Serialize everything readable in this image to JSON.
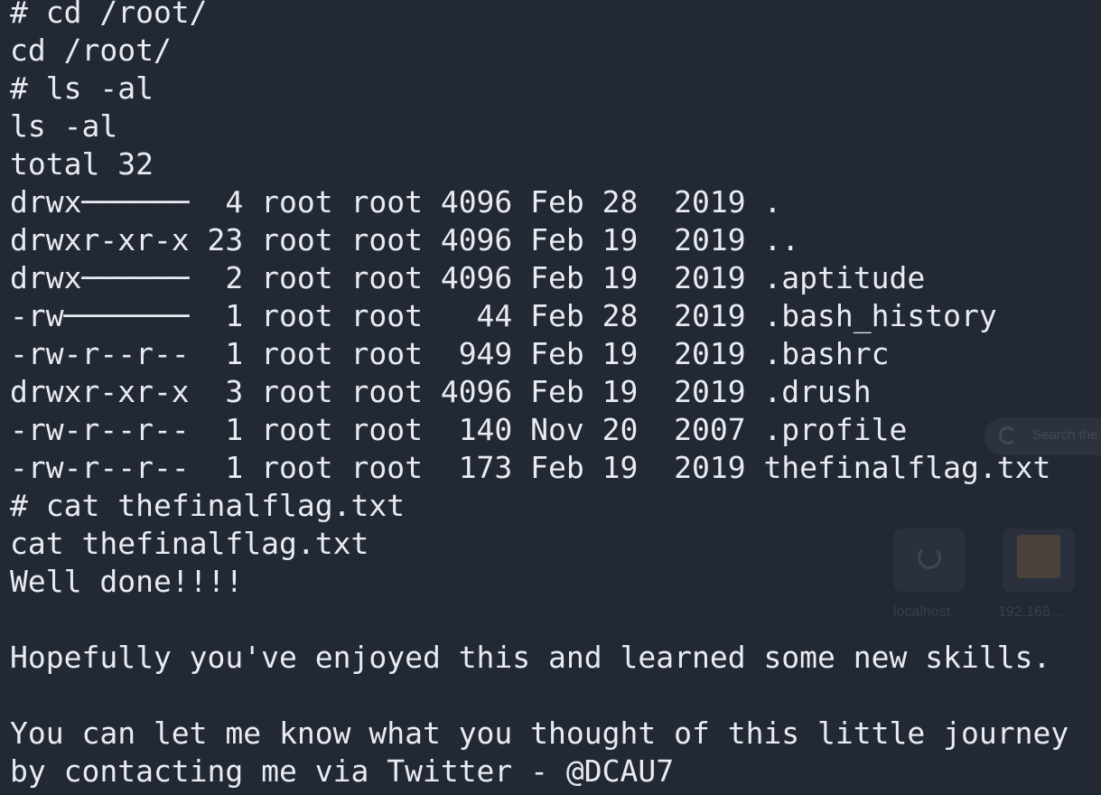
{
  "terminal": {
    "lines": [
      "# cd /root/",
      "cd /root/",
      "# ls -al",
      "ls -al",
      "total 32",
      "drwx──────  4 root root 4096 Feb 28  2019 .",
      "drwxr-xr-x 23 root root 4096 Feb 19  2019 ..",
      "drwx──────  2 root root 4096 Feb 19  2019 .aptitude",
      "-rw───────  1 root root   44 Feb 28  2019 .bash_history",
      "-rw-r--r--  1 root root  949 Feb 19  2019 .bashrc",
      "drwxr-xr-x  3 root root 4096 Feb 19  2019 .drush",
      "-rw-r--r--  1 root root  140 Nov 20  2007 .profile",
      "-rw-r--r--  1 root root  173 Feb 19  2019 thefinalflag.txt",
      "# cat thefinalflag.txt",
      "cat thefinalflag.txt",
      "Well done!!!!",
      "",
      "Hopefully you've enjoyed this and learned some new skills.",
      "",
      "You can let me know what you thought of this little journey",
      "by contacting me via Twitter - @DCAU7"
    ]
  },
  "background_overlay": {
    "search_label": "Search the",
    "shortcut_1_label": "localhost",
    "shortcut_2_label": "192.168...",
    "search_icon": "google-g-icon",
    "shortcut_1_icon": "refresh-icon",
    "shortcut_2_icon": "site-thumbnail-icon"
  },
  "colors": {
    "background": "#232934",
    "text": "#e8ecf2"
  }
}
